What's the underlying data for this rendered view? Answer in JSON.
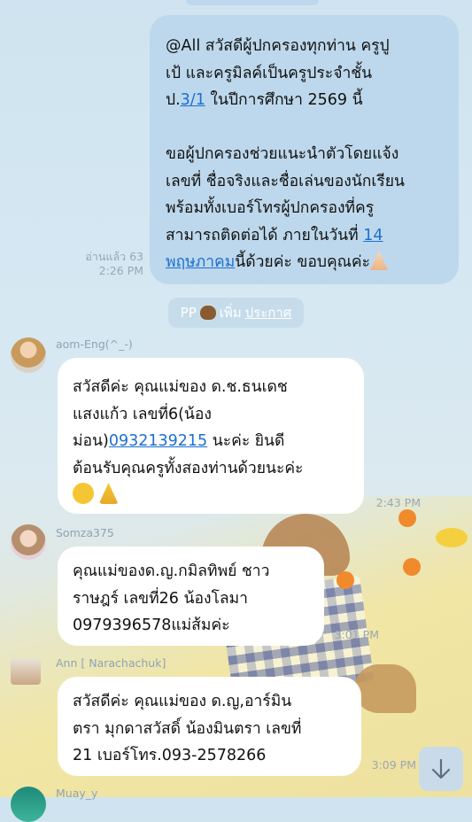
{
  "messages": [
    {
      "sender": "",
      "read_status": "อ่านแล้ว 63",
      "time": "2:26 PM",
      "lines": [
        "@All สวัสดีผู้ปกครองทุกท่าน ครูปู",
        "เป้ และครูมิลค์เป็นครูประจำชั้น",
        [
          "ป.",
          "3/1",
          " ในปีการศึกษา 2569 นี้"
        ],
        "",
        "ขอผู้ปกครองช่วยแนะนำตัวโดยแจ้ง",
        "เลขที่ ชื่อจริงและชื่อเล่นของนักเรียน",
        "พร้อมทั้งเบอร์โทรผู้ปกครองที่ครู",
        [
          "สามารถติดต่อได้ ภายในวันที่ ",
          "14",
          ""
        ],
        [
          "",
          "พฤษภาคม",
          "นี้ด้วยค่ะ ขอบคุณค่ะ"
        ]
      ]
    },
    {
      "sender": "aom-Eng(^_-)",
      "time": "2:43 PM",
      "lines": [
        "สวัสดีค่ะ คุณแม่ของ ด.ช.ธนเดช",
        "แสงแก้ว เลขที่6(น้อง",
        [
          "ม่อน)",
          "0932139215",
          " นะค่ะ  ยินดี"
        ],
        "ต้อนรับคุณครูทั้งสองท่านด้วยนะค่ะ"
      ]
    },
    {
      "sender": "Somza375",
      "time": "3:01 PM",
      "lines": [
        "คุณแม่ของด.ญ.กมิลทิพย์  ชาว",
        "ราษฎร์  เลขที่26  น้องโลมา",
        "0979396578แม่ส้มค่ะ"
      ]
    },
    {
      "sender": "Ann [ Narachachuk]",
      "time": "3:09 PM",
      "lines": [
        "สวัสดีค่ะ คุณแม่ของ ด.ญ,อาร์มิน",
        "ตรา มุกดาสวัสดิ์ น้องมินตรา เลขที่",
        "21 เบอร์โทร.093-2578266"
      ]
    },
    {
      "sender": "Muay_y"
    }
  ],
  "notice": {
    "prefix": "PP",
    "text": "เพิ่ม",
    "link": "ประกาศ"
  },
  "colors": {
    "link": "#1d6fd1",
    "my_bubble": "#bdd8ec",
    "other_bubble": "#ffffff"
  },
  "icons": {
    "scroll": "arrow-down-icon"
  }
}
